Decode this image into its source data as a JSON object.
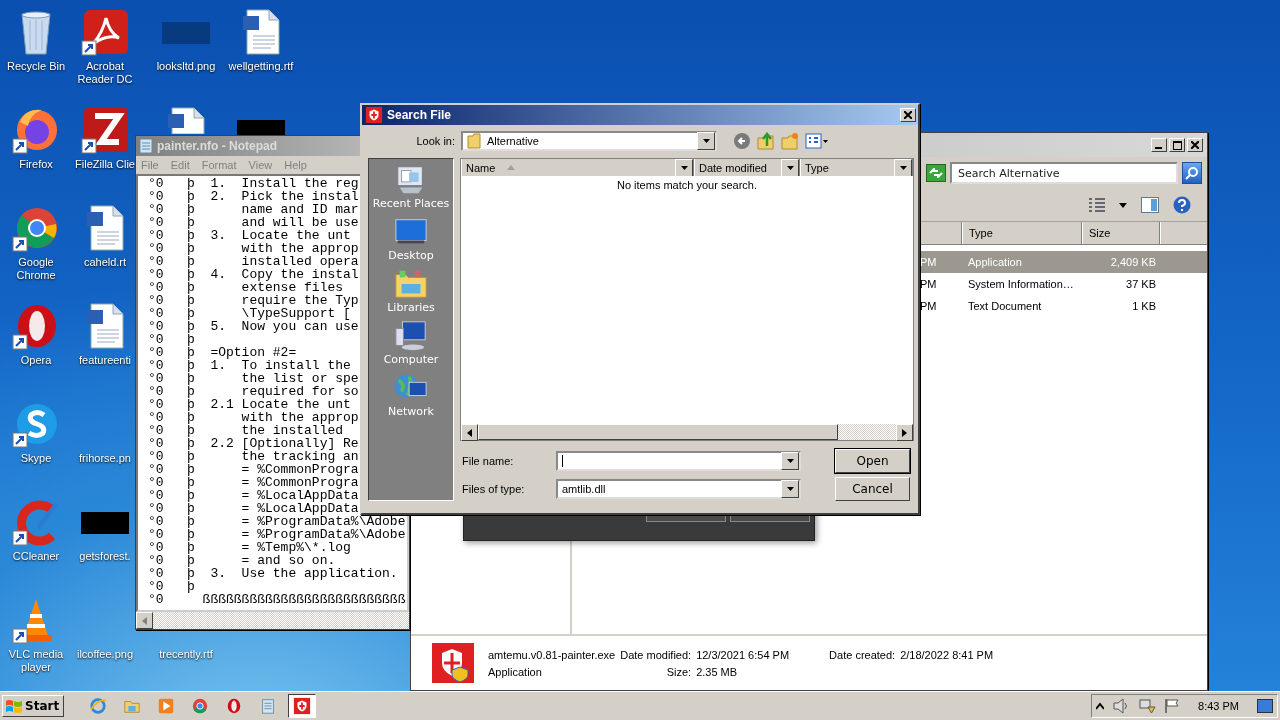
{
  "desktop": {
    "columns": [
      [
        {
          "kind": "recycle",
          "label": "Recycle Bin"
        },
        {
          "kind": "firefox",
          "label": "Firefox"
        },
        {
          "kind": "chrome",
          "label": "Google Chrome"
        },
        {
          "kind": "opera",
          "label": "Opera"
        },
        {
          "kind": "skype",
          "label": "Skype"
        },
        {
          "kind": "ccleaner",
          "label": "CCleaner"
        },
        {
          "kind": "vlc",
          "label": "VLC media player"
        }
      ],
      [
        {
          "kind": "acrobat",
          "label": "Acrobat Reader DC"
        },
        {
          "kind": "filezilla",
          "label": "FileZilla Clie"
        },
        {
          "kind": "word",
          "label": "caheld.rt"
        },
        {
          "kind": "word",
          "label": "featureenti"
        },
        {
          "kind": "none",
          "label": "frihorse.pn"
        },
        {
          "kind": "black",
          "label": "getsforest."
        },
        {
          "kind": "none",
          "label": "ilcoffee.png"
        }
      ],
      [
        {
          "kind": "blank",
          "label": "looksltd.png"
        },
        {
          "kind": "word-top"
        },
        {
          "kind": "none"
        },
        {
          "kind": "none"
        },
        {
          "kind": "none"
        },
        {
          "kind": "none"
        },
        {
          "kind": "none",
          "label": "trecently.rtf"
        }
      ],
      [
        {
          "kind": "word",
          "label": "wellgetting.rtf"
        },
        {
          "kind": "black"
        }
      ]
    ]
  },
  "explorer": {
    "search": {
      "placeholder": "Search Alternative"
    },
    "columns": [
      {
        "label": "Type"
      },
      {
        "label": "Size"
      }
    ],
    "rows": [
      {
        "date": "PM",
        "type": "Application",
        "size": "2,409 KB",
        "selected": true
      },
      {
        "date": "PM",
        "type": "System Information…",
        "size": "37 KB",
        "selected": false
      },
      {
        "date": "PM",
        "type": "Text Document",
        "size": "1 KB",
        "selected": false
      }
    ],
    "details": {
      "name": "amtemu.v0.81-painter.exe",
      "type": "Application",
      "fields": [
        {
          "label": "Date modified:",
          "value": "12/3/2021 6:54 PM"
        },
        {
          "label": "Size:",
          "value": "2.35 MB"
        },
        {
          "label": "Date created:",
          "value": "2/18/2022 8:41 PM"
        }
      ]
    }
  },
  "notepad": {
    "title": "painter.nfo - Notepad",
    "menu": [
      "File",
      "Edit",
      "Format",
      "View",
      "Help"
    ],
    "lines": [
      "°0   þ  1.  Install the reg",
      "°0   þ  2.  Pick the instal",
      "°0   þ      name and ID mar",
      "°0   þ      and will be use",
      "°0   þ  3.  Locate the unt",
      "°0   þ      with the approp",
      "°0   þ      installed opera",
      "°0   þ  4.  Copy the instal",
      "°0   þ      extense files",
      "°0   þ      require the Typ",
      "°0   þ      \\TypeSupport [",
      "°0   þ  5.  Now you can use",
      "°0   þ",
      "°0   þ  =Option #2=",
      "°0   þ  1.  To install the",
      "°0   þ      the list or spe",
      "°0   þ      required for so",
      "°0   þ  2.1 Locate the unt",
      "°0   þ      with the approp",
      "°0   þ      the installed",
      "°0   þ  2.2 [Optionally] Re",
      "°0   þ      the tracking an",
      "°0   þ      = %CommonProgra",
      "°0   þ      = %CommonProgra",
      "°0   þ      = %LocalAppData",
      "°0   þ      = %LocalAppData",
      "°0   þ      = %ProgramData%\\Adobe",
      "°0   þ      = %ProgramData%\\Adobe",
      "°0   þ      = %Temp%\\*.log",
      "°0   þ      = and so on.",
      "°0   þ  3.  Use the application.",
      "°0   þ",
      "°0     ßßßßßßßßßßßßßßßßßßßßßßßßßß"
    ]
  },
  "dialog": {
    "title": "Search File",
    "look_in_label": "Look in:",
    "look_in_value": "Alternative",
    "places": [
      {
        "kind": "recent",
        "label": "Recent Places"
      },
      {
        "kind": "desktop",
        "label": "Desktop"
      },
      {
        "kind": "libraries",
        "label": "Libraries"
      },
      {
        "kind": "computer",
        "label": "Computer"
      },
      {
        "kind": "network",
        "label": "Network"
      }
    ],
    "columns": [
      {
        "label": "Name",
        "sorted": true
      },
      {
        "label": "Date modified",
        "sorted": false
      },
      {
        "label": "Type",
        "sorted": false
      }
    ],
    "empty_message": "No items match your search.",
    "file_name_label": "File name:",
    "file_type_label": "Files of type:",
    "file_type_value": "amtlib.dll",
    "buttons": [
      {
        "label": "Open",
        "default": true
      },
      {
        "label": "Cancel",
        "default": false
      }
    ]
  },
  "taskbar": {
    "start": "Start",
    "items": [
      {
        "kind": "ie",
        "selected": false
      },
      {
        "kind": "folder",
        "selected": false
      },
      {
        "kind": "media",
        "selected": false
      },
      {
        "kind": "chrome",
        "selected": false
      },
      {
        "kind": "opera",
        "selected": false
      },
      {
        "kind": "notepad",
        "selected": false
      },
      {
        "kind": "shield",
        "selected": true
      }
    ],
    "clock": "8:43 PM"
  }
}
